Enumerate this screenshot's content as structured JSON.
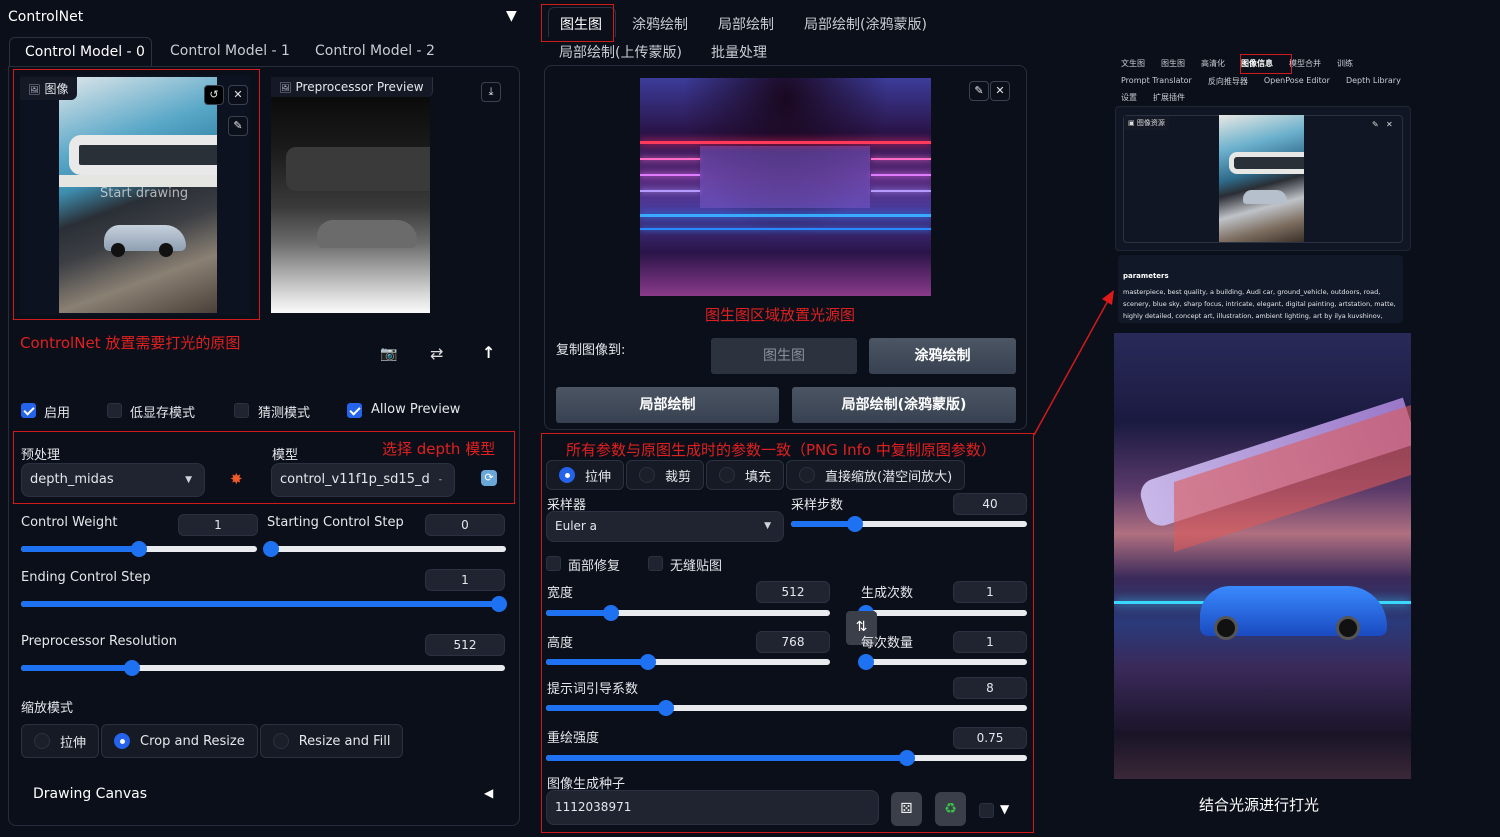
{
  "controlnet": {
    "title": "ControlNet",
    "collapse_icon": "triangle-down-icon",
    "tabs": [
      "Control Model - 0",
      "Control Model - 1",
      "Control Model - 2"
    ],
    "active_tab": 0,
    "image_label": "图像",
    "image_overlay_text": "Start drawing",
    "preview_label": "Preprocessor Preview",
    "annotation_image": "ControlNet 放置需要打光的原图",
    "checkboxes": [
      {
        "label": "启用",
        "checked": true
      },
      {
        "label": "低显存模式",
        "checked": false
      },
      {
        "label": "猜测模式",
        "checked": false
      },
      {
        "label": "Allow Preview",
        "checked": true
      }
    ],
    "preprocessor_label": "预处理",
    "preprocessor_value": "depth_midas",
    "model_label": "模型",
    "model_value": "control_v11f1p_sd15_d",
    "annotation_model": "选择 depth 模型",
    "control_weight": {
      "label": "Control Weight",
      "value": "1",
      "fraction": 0.5
    },
    "starting_step": {
      "label": "Starting Control Step",
      "value": "0",
      "fraction": 0.0
    },
    "ending_step": {
      "label": "Ending Control Step",
      "value": "1",
      "fraction": 1.0
    },
    "preprocessor_resolution": {
      "label": "Preprocessor Resolution",
      "value": "512",
      "fraction": 0.23
    },
    "resize_mode_label": "缩放模式",
    "resize_modes": [
      {
        "label": "拉伸",
        "selected": false
      },
      {
        "label": "Crop and Resize",
        "selected": true
      },
      {
        "label": "Resize and Fill",
        "selected": false
      }
    ],
    "drawing_canvas_label": "Drawing Canvas"
  },
  "img2img": {
    "tabs_row1": [
      "图生图",
      "涂鸦绘制",
      "局部绘制",
      "局部绘制(涂鸦蒙版)"
    ],
    "tabs_row2": [
      "局部绘制(上传蒙版)",
      "批量处理"
    ],
    "active_tab": "图生图",
    "annotation_light": "图生图区域放置光源图",
    "copy_to_label": "复制图像到:",
    "copy_buttons": [
      "图生图",
      "涂鸦绘制",
      "局部绘制",
      "局部绘制(涂鸦蒙版)"
    ],
    "annotation_params": "所有参数与原图生成时的参数一致（PNG Info 中复制原图参数）",
    "resize_modes": [
      {
        "label": "拉伸",
        "selected": true
      },
      {
        "label": "裁剪",
        "selected": false
      },
      {
        "label": "填充",
        "selected": false
      },
      {
        "label": "直接缩放(潜空间放大)",
        "selected": false
      }
    ],
    "sampler_label": "采样器",
    "sampler_value": "Euler a",
    "steps": {
      "label": "采样步数",
      "value": "40",
      "fraction": 0.27
    },
    "face_restore": {
      "label": "面部修复",
      "checked": false
    },
    "tiling": {
      "label": "无缝贴图",
      "checked": false
    },
    "width": {
      "label": "宽度",
      "value": "512",
      "fraction": 0.23
    },
    "height": {
      "label": "高度",
      "value": "768",
      "fraction": 0.36
    },
    "batch_count": {
      "label": "生成次数",
      "value": "1",
      "fraction": 0.0
    },
    "batch_size": {
      "label": "每次数量",
      "value": "1",
      "fraction": 0.0
    },
    "cfg_scale": {
      "label": "提示词引导系数",
      "value": "8",
      "fraction": 0.25
    },
    "denoising": {
      "label": "重绘强度",
      "value": "0.75",
      "fraction": 0.75
    },
    "seed_label": "图像生成种子",
    "seed_value": "1112038971",
    "swap_icon": "swap-arrows-icon",
    "dice_icon": "dice-icon",
    "recycle_icon": "recycle-icon"
  },
  "pnginfo": {
    "tabs_row1": [
      "文生图",
      "图生图",
      "高清化",
      "图像信息",
      "模型合并",
      "训练"
    ],
    "tabs_row2": [
      "Prompt Translator",
      "反向推导器",
      "OpenPose Editor",
      "Depth Library"
    ],
    "tabs_row3": [
      "设置",
      "扩展插件"
    ],
    "active_tab": "图像信息",
    "image_label": "图像资源",
    "params_title": "parameters",
    "params_text": "masterpiece, best quality, a building, Audi car, ground_vehicle, outdoors, road, scenery, blue sky, sharp focus, intricate, elegant, digital painting, artstation, matte, highly detailed, concept art, illustration, ambient lighting, art by ilya kuvshinov, artgerm, Alphonse mucha,",
    "result_caption": "结合光源进行打光"
  },
  "colors": {
    "background": "#0b0f19",
    "accent": "#1e72f2",
    "annotation_red": "#e02020"
  }
}
